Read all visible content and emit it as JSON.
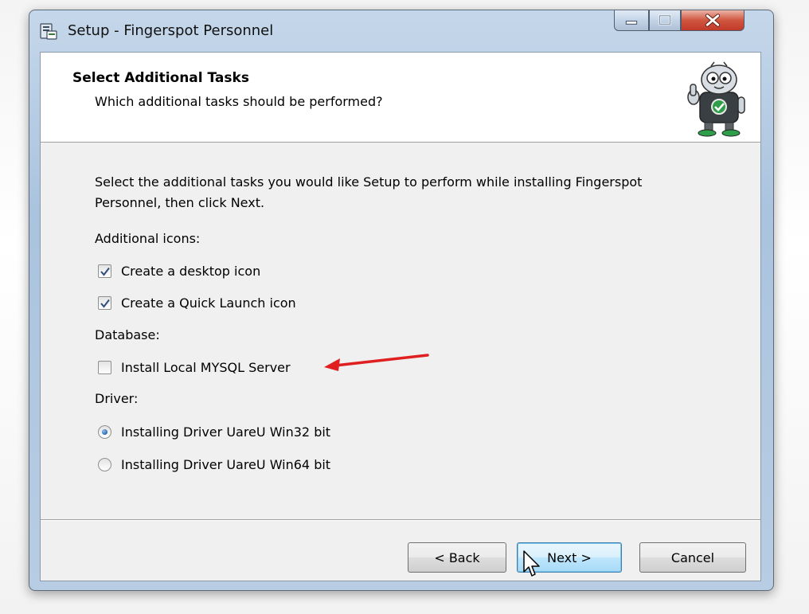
{
  "window": {
    "title": "Setup - Fingerspot Personnel",
    "controls": [
      "minimize-icon",
      "maximize-icon",
      "close-icon"
    ]
  },
  "header": {
    "title": "Select Additional Tasks",
    "subtitle": "Which additional tasks should be performed?"
  },
  "body": {
    "description": "Select the additional tasks you would like Setup to perform while installing Fingerspot Personnel, then click Next.",
    "groups": {
      "icons": {
        "label": "Additional icons:",
        "options": [
          {
            "label": "Create a desktop icon",
            "checked": true
          },
          {
            "label": "Create a Quick Launch icon",
            "checked": true
          }
        ]
      },
      "database": {
        "label": "Database:",
        "options": [
          {
            "label": "Install Local MYSQL Server",
            "checked": false
          }
        ]
      },
      "driver": {
        "label": "Driver:",
        "options": [
          {
            "label": "Installing Driver UareU Win32 bit",
            "selected": true
          },
          {
            "label": "Installing Driver UareU Win64 bit",
            "selected": false
          }
        ]
      }
    }
  },
  "buttons": {
    "back": "< Back",
    "next": "Next >",
    "cancel": "Cancel"
  },
  "colors": {
    "annotation_arrow": "#e02020",
    "close_button": "#c0392b",
    "focused_button_border": "#3c7fb1"
  }
}
